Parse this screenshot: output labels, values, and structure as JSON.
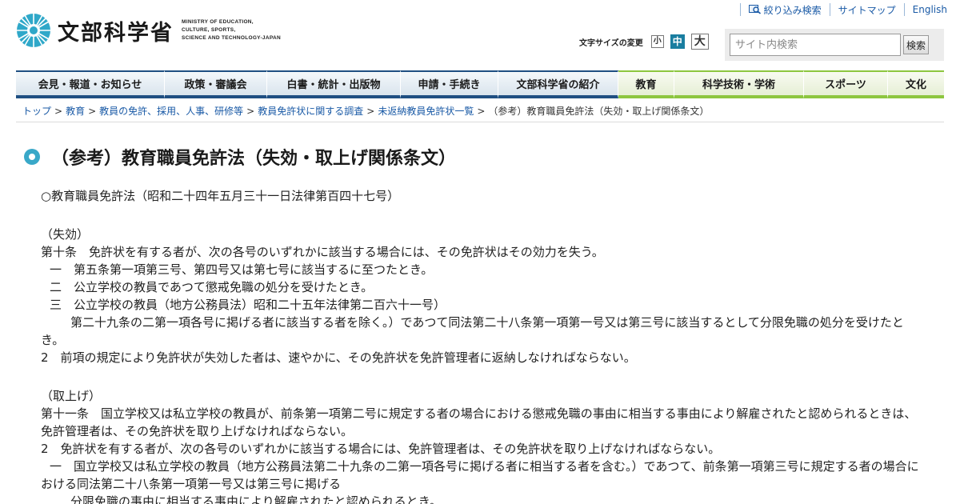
{
  "header": {
    "logo_ja": "文部科学省",
    "logo_en": [
      "MINISTRY OF EDUCATION,",
      "CULTURE, SPORTS,",
      "SCIENCE AND TECHNOLOGY-JAPAN"
    ],
    "util_links": [
      "絞り込み検索",
      "サイトマップ",
      "English"
    ],
    "fontsize": {
      "label": "文字サイズの変更",
      "small": "小",
      "medium": "中",
      "large": "大",
      "selected": "中"
    },
    "search": {
      "placeholder": "サイト内検索",
      "button": "検索"
    }
  },
  "nav": {
    "items": [
      "会見・報道・お知らせ",
      "政策・審議会",
      "白書・統計・出版物",
      "申請・手続き",
      "文部科学省の紹介",
      "教育",
      "科学技術・学術",
      "スポーツ",
      "文化"
    ],
    "colors": {
      "admin": "#1f4f82",
      "field": "#8dc63f"
    }
  },
  "breadcrumb": {
    "items": [
      "トップ",
      "教育",
      "教員の免許、採用、人事、研修等",
      "教員免許状に関する調査",
      "未返納教員免許状一覧",
      "（参考）教育職員免許法（失効・取上げ関係条文）"
    ]
  },
  "page": {
    "title": "（参考）教育職員免許法（失効・取上げ関係条文）",
    "law_title": "○教育職員免許法（昭和二十四年五月三十一日法律第百四十七号）",
    "section1": {
      "heading": "（失効）",
      "article": "第十条　免許状を有する者が、次の各号のいずれかに該当する場合には、その免許状はその効力を失う。",
      "items": [
        "一　第五条第一項第三号、第四号又は第七号に該当するに至つたとき。",
        "二　公立学校の教員であつて懲戒免職の処分を受けたとき。",
        "三　公立学校の教員（地方公務員法）昭和二十五年法律第二百六十一号）"
      ],
      "cont": "　第二十九条の二第一項各号に掲げる者に該当する者を除く。）であつて同法第二十八条第一項第一号又は第三号に該当するとして分限免職の処分を受けたとき。",
      "para2": "2　前項の規定により免許状が失効した者は、速やかに、その免許状を免許管理者に返納しなければならない。"
    },
    "section2": {
      "heading": "（取上げ）",
      "article": "第十一条　国立学校又は私立学校の教員が、前条第一項第二号に規定する者の場合における懲戒免職の事由に相当する事由により解雇されたと認められるときは、免許管理者は、その免許状を取り上げなければならない。",
      "para2": "2　免許状を有する者が、次の各号のいずれかに該当する場合には、免許管理者は、その免許状を取り上げなければならない。",
      "item1": "一　国立学校又は私立学校の教員（地方公務員法第二十九条の二第一項各号に掲げる者に相当する者を含む。）であつて、前条第一項第三号に規定する者の場合における同法第二十八条第一項第一号又は第三号に掲げる",
      "item1_cont": "　分限免職の事由に相当する事由により解雇されたと認められるとき。"
    }
  }
}
